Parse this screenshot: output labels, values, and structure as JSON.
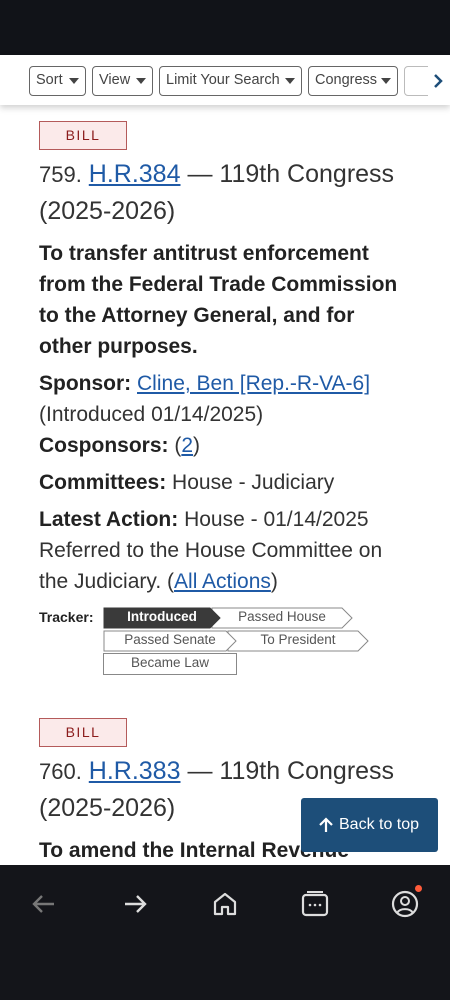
{
  "filters": {
    "sort": "Sort",
    "view": "View",
    "limit": "Limit Your Search",
    "congress": "Congress"
  },
  "results": [
    {
      "badge": "BILL",
      "number": "759.",
      "bill_id": "H.R.384",
      "congress": "— 119th Congress (2025-2026)",
      "title": "To transfer antitrust enforcement from the Federal Trade Commission to the Attorney General, and for other purposes.",
      "sponsor_label": "Sponsor:",
      "sponsor": "Cline, Ben [Rep.-R-VA-6]",
      "introduced": "(Introduced 01/14/2025)",
      "cosponsors_label": "Cosponsors:",
      "cosponsors_count": "2",
      "committees_label": "Committees:",
      "committees": "House - Judiciary",
      "latest_action_label": "Latest Action:",
      "latest_action": "House - 01/14/2025 Referred to the House Committee on the Judiciary.",
      "all_actions": "All Actions",
      "tracker_label": "Tracker:",
      "tracker_steps": [
        "Introduced",
        "Passed House",
        "Passed Senate",
        "To President",
        "Became Law"
      ],
      "tracker_current": "Introduced"
    },
    {
      "badge": "BILL",
      "number": "760.",
      "bill_id": "H.R.383",
      "congress": "— 119th Congress (2025-2026)",
      "title": "To amend the Internal Revenue"
    }
  ],
  "back_to_top": "Back to top",
  "colors": {
    "link": "#1f5aa6",
    "badge_border": "#b45a5a",
    "badge_text": "#8b1c1c",
    "tracker_active": "#3a3a3a",
    "back_to_top_bg": "#1d4e79",
    "nav_bg": "#14151a"
  },
  "icons": {
    "nav": [
      "back-arrow-icon",
      "forward-arrow-icon",
      "home-icon",
      "tabs-icon",
      "profile-icon"
    ]
  }
}
